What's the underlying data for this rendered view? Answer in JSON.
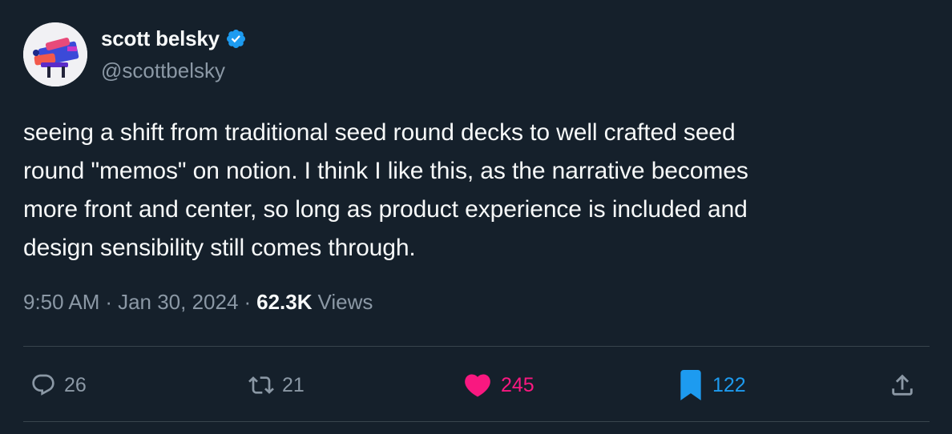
{
  "author": {
    "display_name": "scott belsky",
    "handle": "@scottbelsky",
    "verified_icon": "verified-badge-icon",
    "avatar_icon": "avatar"
  },
  "tweet": {
    "text": "seeing a shift from traditional seed round decks to well crafted seed\nround \"memos\" on notion. I think I like this, as the narrative becomes\nmore front and center, so long as product experience is included and\ndesign sensibility still comes through."
  },
  "meta": {
    "time": "9:50 AM",
    "separator": "·",
    "date": "Jan 30, 2024",
    "views_count": "62.3K",
    "views_label": "Views"
  },
  "actions": {
    "reply": {
      "icon": "reply-icon",
      "count": "26"
    },
    "retweet": {
      "icon": "retweet-icon",
      "count": "21"
    },
    "like": {
      "icon": "heart-icon",
      "count": "245"
    },
    "bookmark": {
      "icon": "bookmark-icon",
      "count": "122"
    },
    "share": {
      "icon": "share-icon"
    }
  },
  "colors": {
    "background": "#15202b",
    "text_primary": "#f7f9f9",
    "text_secondary": "#8b98a5",
    "verified_blue": "#1d9bf0",
    "like_pink": "#f91880",
    "divider": "#38444d"
  }
}
